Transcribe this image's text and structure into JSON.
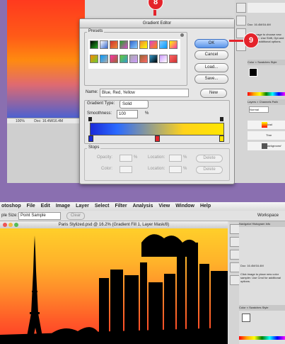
{
  "dialog": {
    "title": "Gradient Editor",
    "presets_label": "Presets",
    "ok_label": "OK",
    "cancel_label": "Cancel",
    "load_label": "Load...",
    "save_label": "Save...",
    "name_label": "Name:",
    "name_value": "Blue, Red, Yellow",
    "new_label": "New",
    "gradient_type_label": "Gradient Type:",
    "gradient_type_value": "Solid",
    "smoothness_label": "Smoothness:",
    "smoothness_value": "100",
    "smoothness_unit": "%",
    "stops_label": "Stops",
    "opacity_label": "Opacity:",
    "opacity_unit": "%",
    "location_label": "Location:",
    "location_unit": "%",
    "color_label": "Color:",
    "delete_label": "Delete",
    "preset_colors": [
      "#000",
      "#fff",
      "#c33",
      "#2a2",
      "#36c",
      "#e83",
      "#d4c",
      "#8cf",
      "#ff0",
      "#f80",
      "#09f",
      "#f3a",
      "#6c3",
      "#aaa",
      "#963",
      "#39c",
      "#c9f",
      "#f66"
    ]
  },
  "top_status": {
    "pct": "100%",
    "doc": "Doc: 16.4M/16.4M"
  },
  "right_panel_top": {
    "info_text": "Click image to choose new fore color. Use Shift, Opt and Cmd for additional options.",
    "doc_size": "Doc: 16.4M/16.4M",
    "color_tabs": "Color × Swatches Style",
    "layers_tabs": "Layers × Channels Path",
    "blend_mode": "Normal",
    "layer_grad": "Grad",
    "layer_thr": "Thre",
    "layer_bg": "Background"
  },
  "callouts": {
    "step8": "8",
    "step9": "9"
  },
  "bottom": {
    "menu_items": [
      "otoshop",
      "File",
      "Edit",
      "Image",
      "Layer",
      "Select",
      "Filter",
      "Analysis",
      "View",
      "Window",
      "Help"
    ],
    "opt_sample_label": "ple Size:",
    "opt_sample_value": "Point Sample",
    "opt_clear": "Clear",
    "doc_title": "Paris Stylized.psd @ 16.2% (Gradient Fill 1, Layer Mask/8)",
    "workspace": "Workspace",
    "nav_tabs": "Navigator  Histogram  Info",
    "info_text": "Click image to place new color sampler. Use Cmd for additional options.",
    "doc_size": "Doc: 16.4M/16.4M",
    "color_tabs": "Color × Swatches Style"
  }
}
